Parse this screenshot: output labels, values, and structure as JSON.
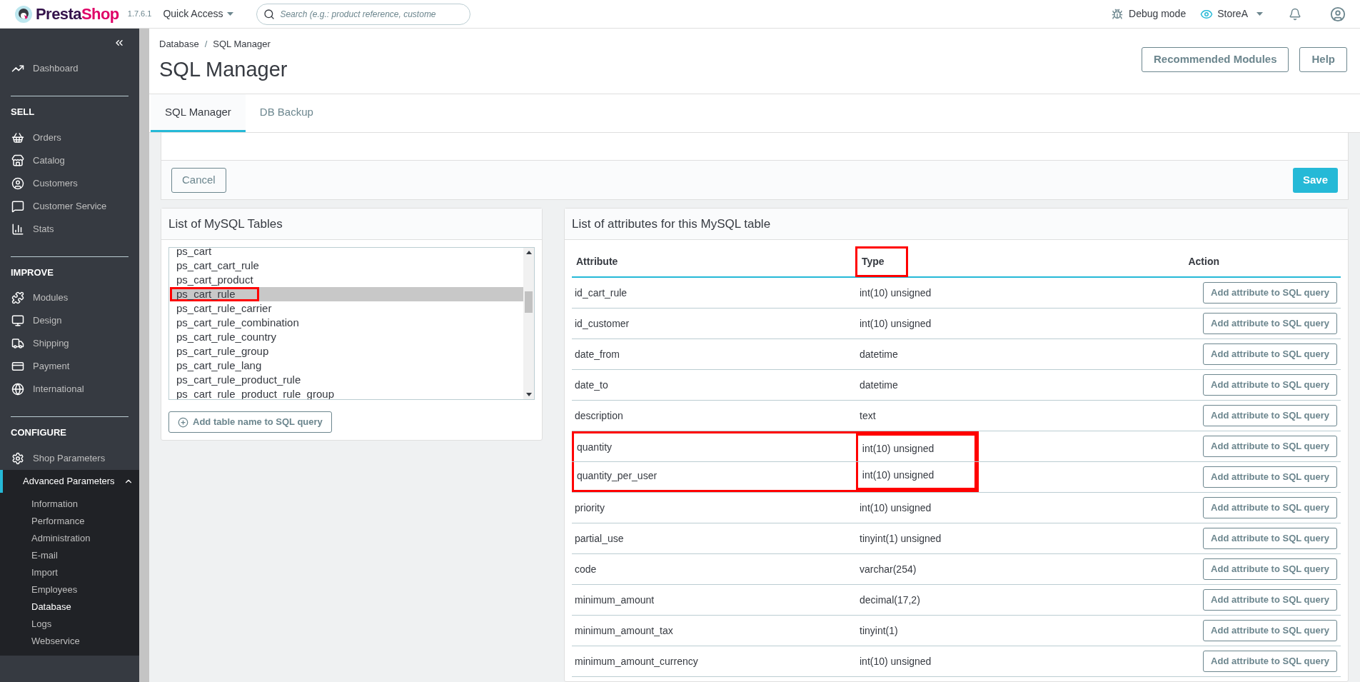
{
  "topbar": {
    "logo": [
      "Presta",
      "Shop"
    ],
    "version": "1.7.6.1",
    "quick_access": "Quick Access",
    "search": {
      "placeholder": "Search (e.g.: product reference, custome"
    },
    "debug": "Debug mode",
    "store": "StoreA"
  },
  "sidebar": {
    "top": [
      {
        "label": "Dashboard",
        "selected": false
      }
    ],
    "sections": [
      {
        "title": "SELL",
        "items": [
          {
            "label": "Orders",
            "selected": false
          },
          {
            "label": "Catalog",
            "selected": false
          },
          {
            "label": "Customers",
            "selected": false
          },
          {
            "label": "Customer Service",
            "selected": false
          },
          {
            "label": "Stats",
            "selected": false
          }
        ]
      },
      {
        "title": "IMPROVE",
        "items": [
          {
            "label": "Modules",
            "selected": false
          },
          {
            "label": "Design",
            "selected": false
          },
          {
            "label": "Shipping",
            "selected": false
          },
          {
            "label": "Payment",
            "selected": false
          },
          {
            "label": "International",
            "selected": false
          }
        ]
      },
      {
        "title": "CONFIGURE",
        "items": [
          {
            "label": "Shop Parameters",
            "selected": false
          },
          {
            "label": "Advanced Parameters",
            "selected": true,
            "expanded": true,
            "children": [
              {
                "label": "Information",
                "selected": false
              },
              {
                "label": "Performance",
                "selected": false
              },
              {
                "label": "Administration",
                "selected": false
              },
              {
                "label": "E-mail",
                "selected": false
              },
              {
                "label": "Import",
                "selected": false
              },
              {
                "label": "Employees",
                "selected": false
              },
              {
                "label": "Database",
                "selected": true
              },
              {
                "label": "Logs",
                "selected": false
              },
              {
                "label": "Webservice",
                "selected": false
              }
            ]
          }
        ]
      }
    ]
  },
  "header": {
    "breadcrumb": [
      "Database",
      "SQL Manager"
    ],
    "breadcrumb_separator": "/",
    "title": "SQL Manager",
    "buttons": [
      "Recommended Modules",
      "Help"
    ]
  },
  "tabs": [
    {
      "label": "SQL Manager",
      "selected": true
    },
    {
      "label": "DB Backup",
      "selected": false
    }
  ],
  "form_buttons": {
    "cancel": "Cancel",
    "save": "Save"
  },
  "tables_panel": {
    "title": "List of MySQL Tables",
    "items": [
      {
        "label": "ps_cart",
        "selected": false,
        "highlighted": false
      },
      {
        "label": "ps_cart_cart_rule",
        "selected": false,
        "highlighted": false
      },
      {
        "label": "ps_cart_product",
        "selected": false,
        "highlighted": false
      },
      {
        "label": "ps_cart_rule",
        "selected": true,
        "highlighted": true
      },
      {
        "label": "ps_cart_rule_carrier",
        "selected": false,
        "highlighted": false
      },
      {
        "label": "ps_cart_rule_combination",
        "selected": false,
        "highlighted": false
      },
      {
        "label": "ps_cart_rule_country",
        "selected": false,
        "highlighted": false
      },
      {
        "label": "ps_cart_rule_group",
        "selected": false,
        "highlighted": false
      },
      {
        "label": "ps_cart_rule_lang",
        "selected": false,
        "highlighted": false
      },
      {
        "label": "ps_cart_rule_product_rule",
        "selected": false,
        "highlighted": false
      },
      {
        "label": "ps_cart_rule_product_rule_group",
        "selected": false,
        "highlighted": false
      }
    ],
    "add_button": "Add table name to SQL query"
  },
  "attributes_panel": {
    "title": "List of attributes for this MySQL table",
    "columns": [
      {
        "label": "Attribute",
        "highlighted": false
      },
      {
        "label": "Type",
        "highlighted": true
      },
      {
        "label": "Action",
        "highlighted": false
      }
    ],
    "rows": [
      {
        "attribute": "id_cart_rule",
        "type": "int(10) unsigned",
        "action": "Add attribute to SQL query",
        "highlighted": false
      },
      {
        "attribute": "id_customer",
        "type": "int(10) unsigned",
        "action": "Add attribute to SQL query",
        "highlighted": false
      },
      {
        "attribute": "date_from",
        "type": "datetime",
        "action": "Add attribute to SQL query",
        "highlighted": false
      },
      {
        "attribute": "date_to",
        "type": "datetime",
        "action": "Add attribute to SQL query",
        "highlighted": false
      },
      {
        "attribute": "description",
        "type": "text",
        "action": "Add attribute to SQL query",
        "highlighted": false
      },
      {
        "attribute": "quantity",
        "type": "int(10) unsigned",
        "action": "Add attribute to SQL query",
        "highlighted": true
      },
      {
        "attribute": "quantity_per_user",
        "type": "int(10) unsigned",
        "action": "Add attribute to SQL query",
        "highlighted": true
      },
      {
        "attribute": "priority",
        "type": "int(10) unsigned",
        "action": "Add attribute to SQL query",
        "highlighted": false
      },
      {
        "attribute": "partial_use",
        "type": "tinyint(1) unsigned",
        "action": "Add attribute to SQL query",
        "highlighted": false
      },
      {
        "attribute": "code",
        "type": "varchar(254)",
        "action": "Add attribute to SQL query",
        "highlighted": false
      },
      {
        "attribute": "minimum_amount",
        "type": "decimal(17,2)",
        "action": "Add attribute to SQL query",
        "highlighted": false
      },
      {
        "attribute": "minimum_amount_tax",
        "type": "tinyint(1)",
        "action": "Add attribute to SQL query",
        "highlighted": false
      },
      {
        "attribute": "minimum_amount_currency",
        "type": "int(10) unsigned",
        "action": "Add attribute to SQL query",
        "highlighted": false
      }
    ]
  }
}
